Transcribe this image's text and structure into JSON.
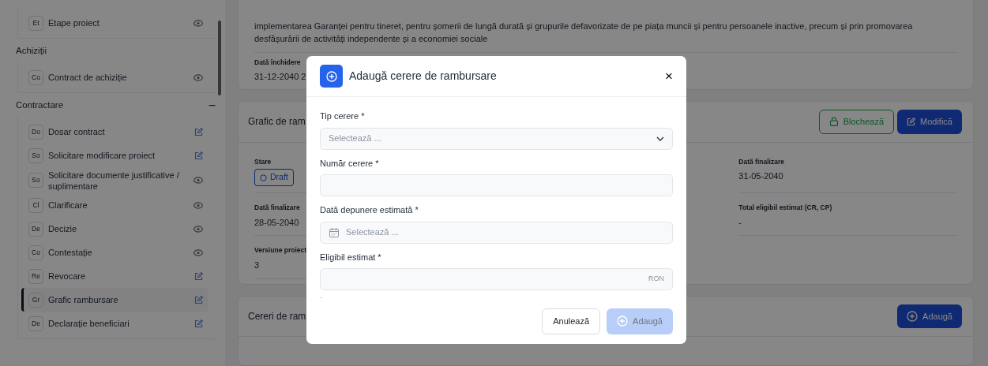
{
  "sidebar": {
    "groups": [
      {
        "items": [
          {
            "abbr": "Et",
            "label": "Etape proiect",
            "kind": "view",
            "selected": false
          }
        ]
      },
      {
        "title": "Achiziții",
        "items": [
          {
            "abbr": "Co",
            "label": "Contract de achiziție",
            "kind": "view",
            "selected": false
          }
        ]
      },
      {
        "title": "Contractare",
        "toggle": "−",
        "items": [
          {
            "abbr": "Do",
            "label": "Dosar contract",
            "kind": "edit",
            "selected": false
          },
          {
            "abbr": "So",
            "label": "Solicitare modificare proiect",
            "kind": "edit",
            "selected": false
          },
          {
            "abbr": "So",
            "label": "Solicitare documente justificative / suplimentare",
            "kind": "view",
            "selected": false
          },
          {
            "abbr": "Cl",
            "label": "Clarificare",
            "kind": "view",
            "selected": false
          },
          {
            "abbr": "De",
            "label": "Decizie",
            "kind": "view",
            "selected": false
          },
          {
            "abbr": "Co",
            "label": "Contestație",
            "kind": "view",
            "selected": false
          },
          {
            "abbr": "Re",
            "label": "Revocare",
            "kind": "edit",
            "selected": false
          },
          {
            "abbr": "Gr",
            "label": "Grafic rambursare",
            "kind": "edit",
            "selected": true
          },
          {
            "abbr": "De",
            "label": "Declarație beneficiari",
            "kind": "edit",
            "selected": false
          }
        ]
      }
    ]
  },
  "description": "implementarea Garanței pentru tineret, pentru șomerii de lungă durată și grupurile defavorizate de pe piața muncii și pentru persoanele inactive, precum și prin promovarea desfășurării de activități independente și a economiei sociale",
  "closing": {
    "label": "Dată închidere",
    "value": "31-12-2040 2"
  },
  "schedule": {
    "title": "Grafic de ram",
    "buttons": [
      {
        "label": "Blochează",
        "kind": "lock"
      },
      {
        "label": "Modifică",
        "kind": "edit"
      }
    ],
    "rows": [
      {
        "left": {
          "label": "Stare",
          "badge": "Draft"
        },
        "right": {
          "label": "Dată finalizare",
          "value": "31-05-2040"
        }
      },
      {
        "left": {
          "label": "Dată finalizare",
          "value": "28-05-2040"
        },
        "right": {
          "label": "Total eligibil estimat (CR, CP)",
          "value": "-"
        }
      },
      {
        "left": {
          "label": "Versiune proiect",
          "value": "3"
        }
      }
    ]
  },
  "requests": {
    "title": "Cereri de ram",
    "button": "Adaugă"
  },
  "modal": {
    "title": "Adaugă cerere de rambursare",
    "close": "×",
    "fields": [
      {
        "kind": "select",
        "label": "Tip cerere *",
        "placeholder": "Selectează ..."
      },
      {
        "kind": "text",
        "label": "Număr cerere *"
      },
      {
        "kind": "date",
        "label": "Dată depunere estimată *",
        "placeholder": "Selectează ..."
      },
      {
        "kind": "amount",
        "label": "Eligibil estimat *",
        "suffix": "RON",
        "hint": "-"
      }
    ],
    "cancel": "Anulează",
    "submit": {
      "label": "Adaugă",
      "disabled": true
    }
  }
}
